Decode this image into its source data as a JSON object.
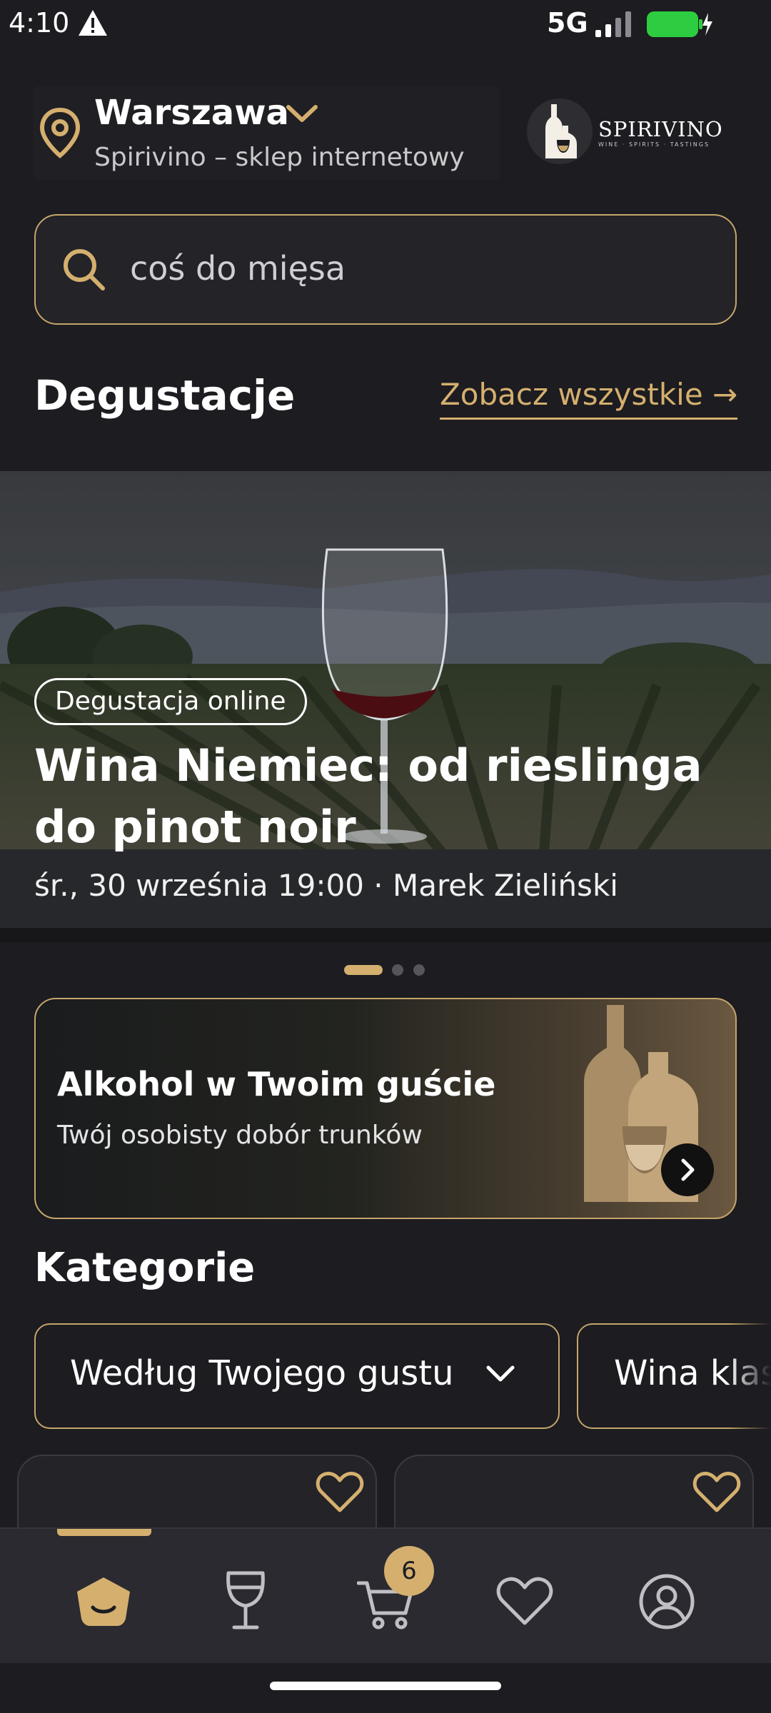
{
  "status_bar": {
    "time": "4:10",
    "network": "5G",
    "icons": [
      "warning-icon",
      "signal-icon",
      "battery-charging-icon"
    ]
  },
  "header": {
    "city": "Warszawa",
    "subtitle": "Spirivino – sklep internetowy",
    "logo_text": "SPIRIVINO",
    "logo_tagline": "WINE · SPIRITS · TASTINGS"
  },
  "search": {
    "placeholder": "coś do mięsa"
  },
  "tastings": {
    "title": "Degustacje",
    "see_all": "Zobacz wszystkie →",
    "hero": {
      "badge": "Degustacja online",
      "title": "Wina Niemiec: od rieslinga do pinot noir",
      "meta": "śr., 30 września 19:00 · Marek Zieliński"
    },
    "carousel": {
      "pages": 3,
      "active": 1
    }
  },
  "promo": {
    "title": "Alkohol w Twoim guście",
    "subtitle": "Twój osobisty dobór trunków"
  },
  "categories": {
    "title": "Kategorie",
    "chips": [
      "Według Twojego gustu",
      "Wina klasyczne"
    ]
  },
  "bottom_nav": {
    "items": [
      "home",
      "wine",
      "cart",
      "favorites",
      "profile"
    ],
    "active": "home",
    "cart_count": "6"
  },
  "colors": {
    "background": "#1c1c21",
    "accent": "#d4af6e",
    "nav_background": "#2a2a30",
    "battery": "#2ecc40"
  }
}
